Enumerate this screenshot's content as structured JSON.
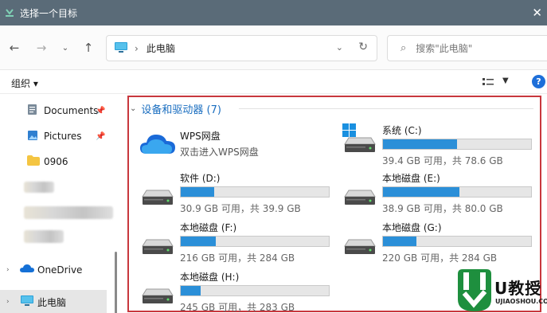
{
  "window": {
    "title": "选择一个目标"
  },
  "nav": {
    "breadcrumb": "此电脑",
    "search_placeholder": "搜索\"此电脑\""
  },
  "toolbar": {
    "organize_label": "组织 ▾"
  },
  "sidebar": {
    "items": [
      {
        "label": "Documents",
        "icon": "documents-icon",
        "pinned": true
      },
      {
        "label": "Pictures",
        "icon": "pictures-icon",
        "pinned": true
      },
      {
        "label": "0906",
        "icon": "folder-icon"
      },
      {
        "label": "OneDrive",
        "icon": "onedrive-icon"
      },
      {
        "label": "此电脑",
        "icon": "this-pc-icon",
        "selected": true
      }
    ]
  },
  "main": {
    "group_title": "设备和驱动器 (7)",
    "drives": [
      {
        "name": "WPS网盘",
        "subtitle": "双击进入WPS网盘",
        "type": "cloud"
      },
      {
        "name": "系统 (C:)",
        "info": "39.4 GB 可用，共 78.6 GB",
        "used_fraction": 0.499,
        "system": true
      },
      {
        "name": "软件 (D:)",
        "info": "30.9 GB 可用，共 39.9 GB",
        "used_fraction": 0.226
      },
      {
        "name": "本地磁盘 (E:)",
        "info": "38.9 GB 可用，共 80.0 GB",
        "used_fraction": 0.514
      },
      {
        "name": "本地磁盘 (F:)",
        "info": "216 GB 可用，共 284 GB",
        "used_fraction": 0.239
      },
      {
        "name": "本地磁盘 (G:)",
        "info": "220 GB 可用，共 284 GB",
        "used_fraction": 0.225
      },
      {
        "name": "本地磁盘 (H:)",
        "info": "245 GB 可用，共 283 GB",
        "used_fraction": 0.134
      }
    ]
  },
  "watermark": {
    "brand": "U教授",
    "domain": "UJIAOSHOU.COM"
  },
  "colors": {
    "accent": "#2b8fd8",
    "titlebar": "#5a6b78",
    "highlight_border": "#c8373d"
  }
}
